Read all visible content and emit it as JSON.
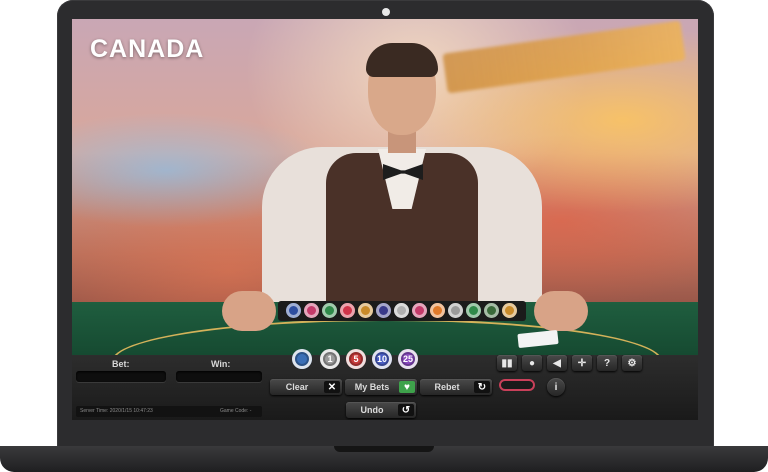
{
  "brand": {
    "title": "CANADA"
  },
  "panel": {
    "bet_label": "Bet:",
    "win_label": "Win:",
    "server_time": "Server Time: 2020/1/15 10:47:23",
    "game_code": "Game Code: -"
  },
  "bet_chips": [
    {
      "label": "",
      "color": "#3b6fb6"
    },
    {
      "label": "1",
      "color": "#9b9b9b"
    },
    {
      "label": "5",
      "color": "#c73a3a"
    },
    {
      "label": "10",
      "color": "#4a5ec4"
    },
    {
      "label": "25",
      "color": "#8a4ac0"
    }
  ],
  "buttons": {
    "clear": "Clear",
    "my_bets": "My Bets",
    "rebet": "Rebet",
    "undo": "Undo"
  },
  "controls": [
    "stats-icon",
    "chat-icon",
    "sound-icon",
    "fullscreen-icon",
    "help-icon",
    "settings-icon"
  ],
  "colors": {
    "felt": "#1f5e3f",
    "accent_green": "#3ea24b",
    "accent_red": "#c9405a"
  }
}
